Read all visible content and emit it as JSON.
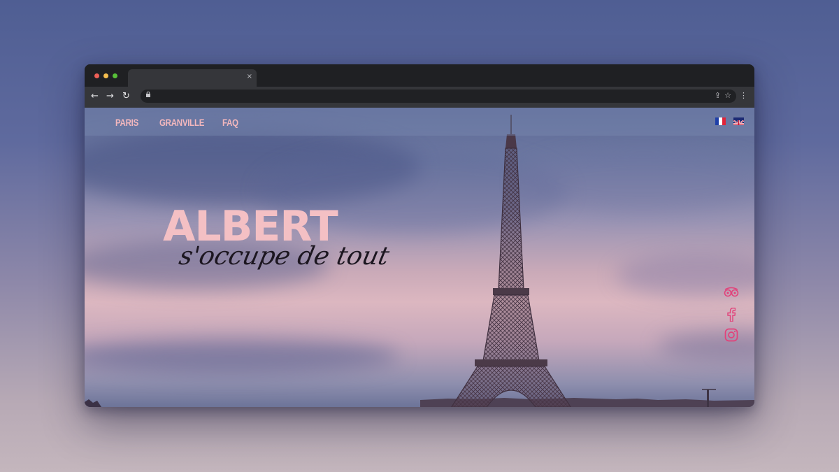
{
  "browser": {
    "tab_title": "",
    "tab_close": "×",
    "back": "←",
    "forward": "→",
    "reload": "↻",
    "lock": "🔒",
    "share": "⇪",
    "bookmark": "☆",
    "menu": "⋮"
  },
  "nav": {
    "links": [
      "PARIS",
      "GRANVILLE",
      "FAQ"
    ],
    "languages": [
      "fr",
      "en"
    ]
  },
  "hero": {
    "title": "ALBERT",
    "subtitle": "s'occupe de tout"
  },
  "social": {
    "icons": [
      "tripadvisor-icon",
      "facebook-icon",
      "instagram-icon"
    ]
  },
  "colors": {
    "accent": "#f2b7bd",
    "social": "#e2427a",
    "title": "#f4c0c4"
  }
}
